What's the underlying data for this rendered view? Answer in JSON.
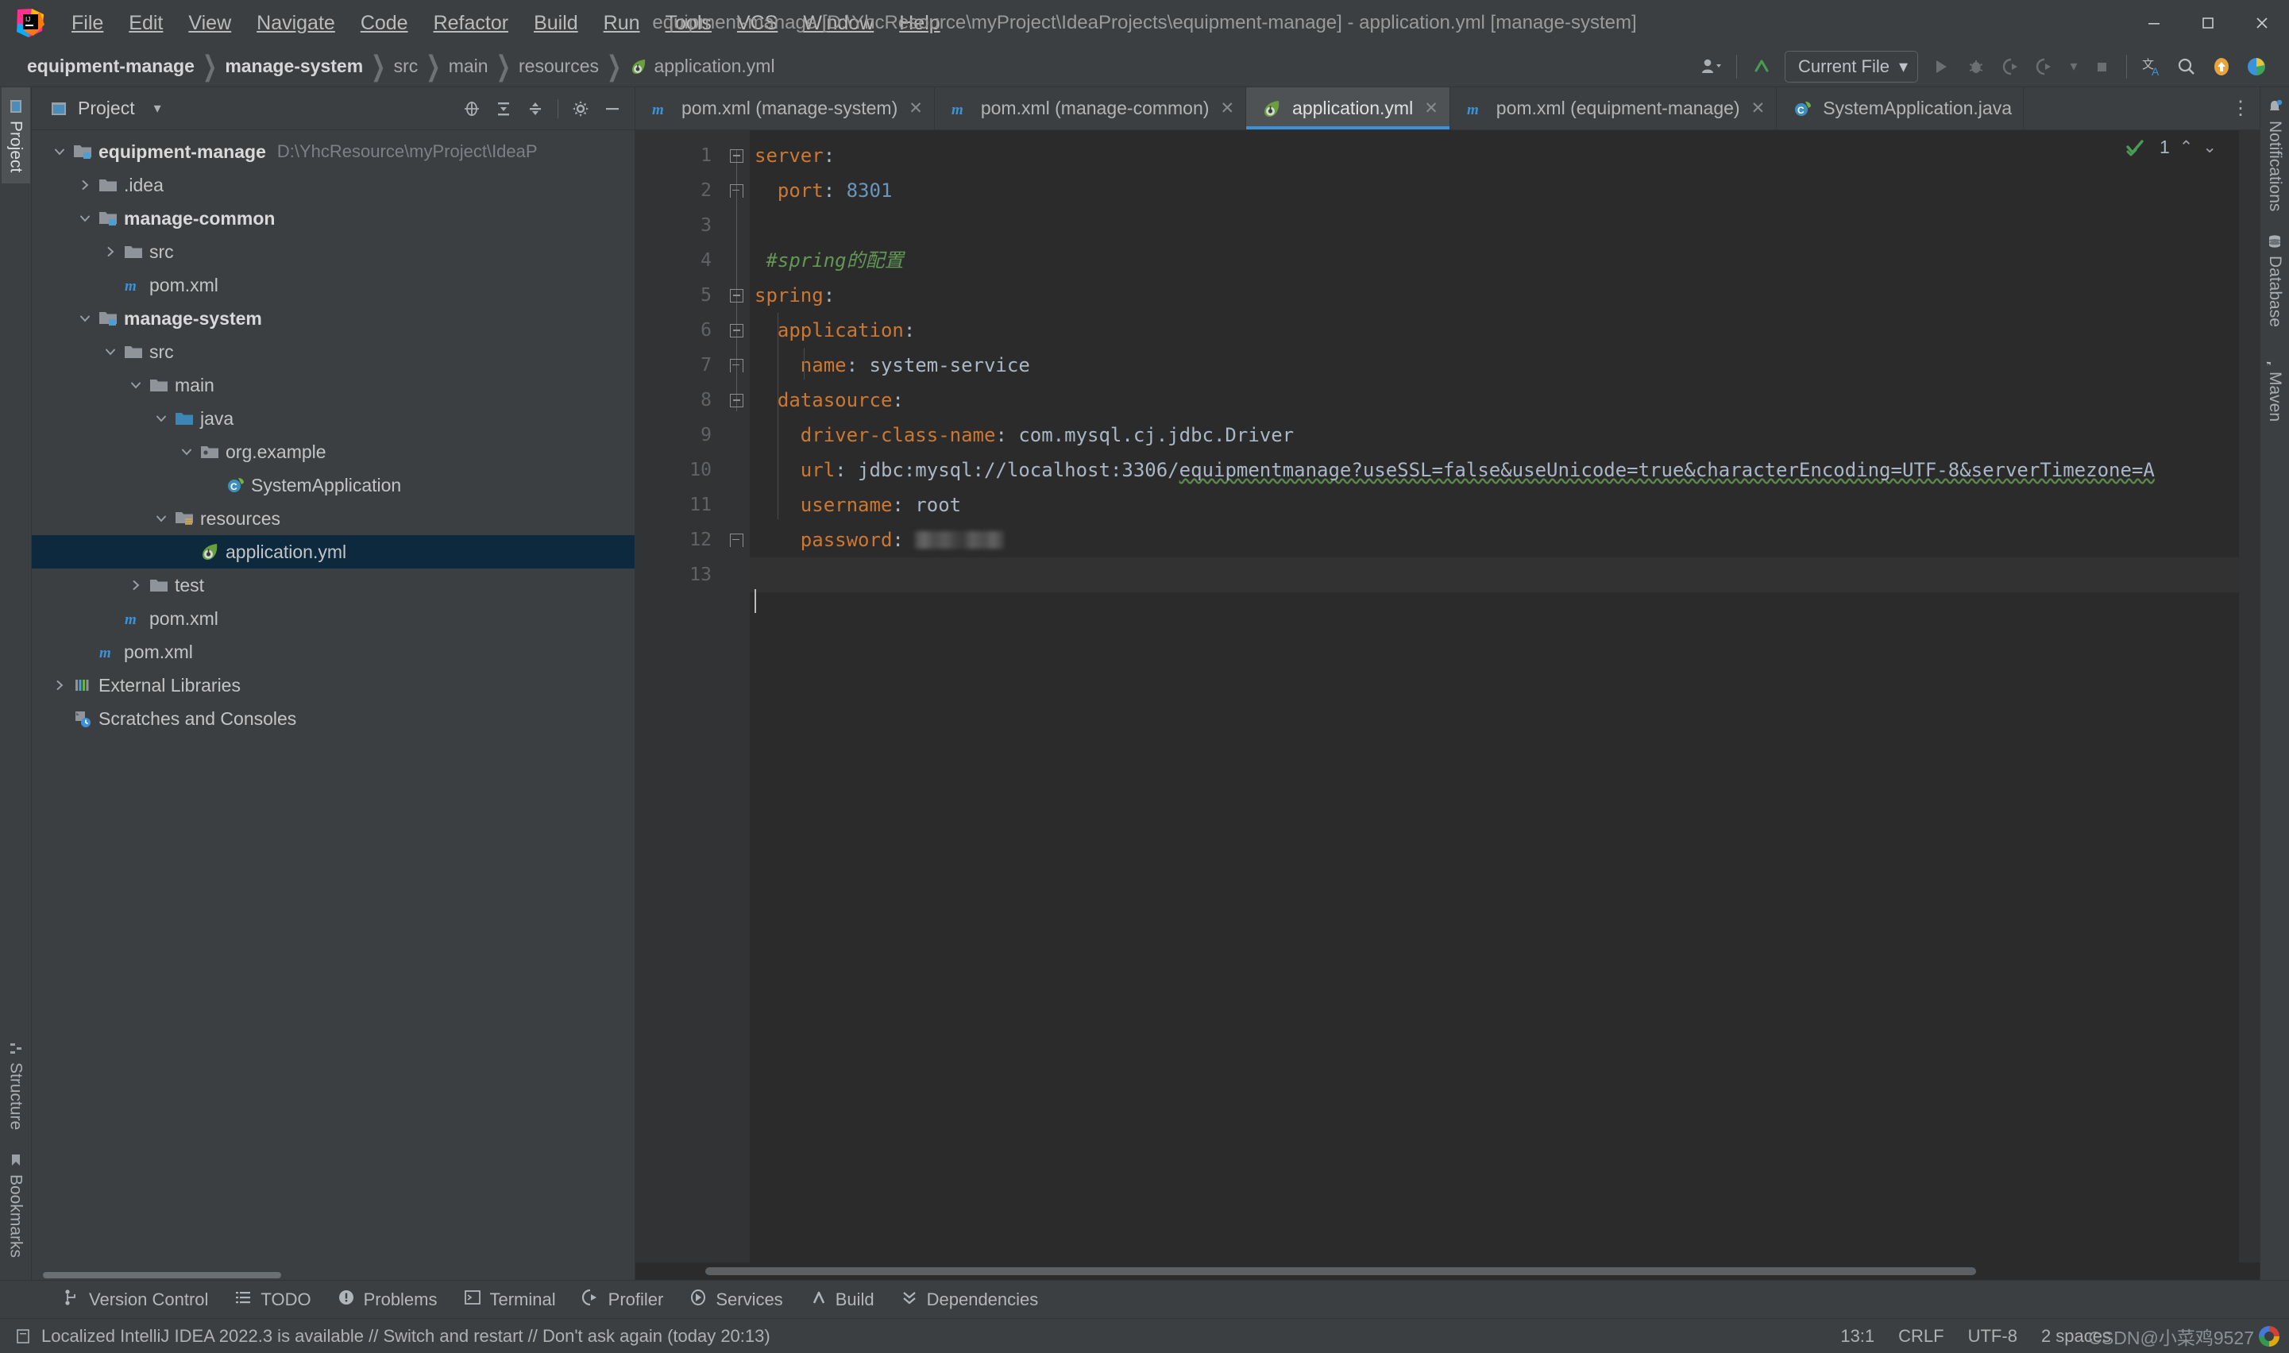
{
  "window": {
    "title": "equipment-manage [D:\\YhcResource\\myProject\\IdeaProjects\\equipment-manage] - application.yml [manage-system]",
    "minimize": "–",
    "maximize": "❐",
    "close": "✕"
  },
  "menu": [
    {
      "label": "File",
      "mnemonic": "F"
    },
    {
      "label": "Edit",
      "mnemonic": "E"
    },
    {
      "label": "View",
      "mnemonic": "V"
    },
    {
      "label": "Navigate",
      "mnemonic": "N"
    },
    {
      "label": "Code",
      "mnemonic": "C"
    },
    {
      "label": "Refactor",
      "mnemonic": "R"
    },
    {
      "label": "Build",
      "mnemonic": "B"
    },
    {
      "label": "Run",
      "mnemonic": "n"
    },
    {
      "label": "Tools",
      "mnemonic": "T"
    },
    {
      "label": "VCS",
      "mnemonic": "S"
    },
    {
      "label": "Window",
      "mnemonic": "W"
    },
    {
      "label": "Help",
      "mnemonic": "H"
    }
  ],
  "breadcrumbs": [
    {
      "label": "equipment-manage",
      "bold": true,
      "icon": null
    },
    {
      "label": "manage-system",
      "bold": true,
      "icon": null
    },
    {
      "label": "src",
      "bold": false,
      "icon": null
    },
    {
      "label": "main",
      "bold": false,
      "icon": null
    },
    {
      "label": "resources",
      "bold": false,
      "icon": null
    },
    {
      "label": "application.yml",
      "bold": false,
      "icon": "yaml-file-icon"
    }
  ],
  "toolbar": {
    "run_config": "Current File",
    "icons": [
      "user-account-icon",
      "updates-icon",
      "run-icon",
      "debug-icon",
      "run-coverage-icon",
      "profile-icon",
      "stop-icon",
      "translate-icon",
      "search-everywhere-icon",
      "update-project-icon",
      "ide-eye-icon"
    ]
  },
  "left_strip": {
    "top": [
      {
        "label": "Project",
        "icon": "project-icon",
        "active": true
      }
    ],
    "bottom": [
      {
        "label": "Structure",
        "icon": "structure-icon",
        "active": false
      },
      {
        "label": "Bookmarks",
        "icon": "bookmarks-icon",
        "active": false
      }
    ]
  },
  "right_strip": [
    {
      "label": "Notifications",
      "icon": "bell-icon"
    },
    {
      "label": "Database",
      "icon": "database-icon"
    },
    {
      "label": "Maven",
      "icon": "maven-icon"
    }
  ],
  "project_panel": {
    "title": "Project",
    "tools": [
      "locate-icon",
      "expand-all-icon",
      "collapse-all-icon",
      "gear-icon",
      "hide-icon"
    ],
    "tree": [
      {
        "depth": 0,
        "arrow": "down",
        "icon": "module-icon",
        "label": "equipment-manage",
        "bold": true,
        "path": "D:\\YhcResource\\myProject\\IdeaP",
        "selected": false
      },
      {
        "depth": 1,
        "arrow": "right",
        "icon": "folder-icon",
        "label": ".idea",
        "bold": false,
        "path": "",
        "selected": false
      },
      {
        "depth": 1,
        "arrow": "down",
        "icon": "module-icon",
        "label": "manage-common",
        "bold": true,
        "path": "",
        "selected": false
      },
      {
        "depth": 2,
        "arrow": "right",
        "icon": "folder-icon",
        "label": "src",
        "bold": false,
        "path": "",
        "selected": false
      },
      {
        "depth": 2,
        "arrow": "none",
        "icon": "maven-file-icon",
        "label": "pom.xml",
        "bold": false,
        "path": "",
        "selected": false
      },
      {
        "depth": 1,
        "arrow": "down",
        "icon": "module-icon",
        "label": "manage-system",
        "bold": true,
        "path": "",
        "selected": false
      },
      {
        "depth": 2,
        "arrow": "down",
        "icon": "folder-icon",
        "label": "src",
        "bold": false,
        "path": "",
        "selected": false
      },
      {
        "depth": 3,
        "arrow": "down",
        "icon": "folder-icon",
        "label": "main",
        "bold": false,
        "path": "",
        "selected": false
      },
      {
        "depth": 4,
        "arrow": "down",
        "icon": "source-root-icon",
        "label": "java",
        "bold": false,
        "path": "",
        "selected": false
      },
      {
        "depth": 5,
        "arrow": "down",
        "icon": "package-icon",
        "label": "org.example",
        "bold": false,
        "path": "",
        "selected": false
      },
      {
        "depth": 6,
        "arrow": "none",
        "icon": "spring-class-icon",
        "label": "SystemApplication",
        "bold": false,
        "path": "",
        "selected": false
      },
      {
        "depth": 4,
        "arrow": "down",
        "icon": "resource-root-icon",
        "label": "resources",
        "bold": false,
        "path": "",
        "selected": false
      },
      {
        "depth": 5,
        "arrow": "none",
        "icon": "yaml-file-icon",
        "label": "application.yml",
        "bold": false,
        "path": "",
        "selected": true
      },
      {
        "depth": 3,
        "arrow": "right",
        "icon": "folder-icon",
        "label": "test",
        "bold": false,
        "path": "",
        "selected": false
      },
      {
        "depth": 2,
        "arrow": "none",
        "icon": "maven-file-icon",
        "label": "pom.xml",
        "bold": false,
        "path": "",
        "selected": false
      },
      {
        "depth": 1,
        "arrow": "none",
        "icon": "maven-file-icon",
        "label": "pom.xml",
        "bold": false,
        "path": "",
        "selected": false
      },
      {
        "depth": 0,
        "arrow": "right",
        "icon": "libraries-icon",
        "label": "External Libraries",
        "bold": false,
        "path": "",
        "selected": false
      },
      {
        "depth": 0,
        "arrow": "none",
        "icon": "scratches-icon",
        "label": "Scratches and Consoles",
        "bold": false,
        "path": "",
        "selected": false
      }
    ]
  },
  "editor_tabs": [
    {
      "label": "pom.xml (manage-system)",
      "icon": "maven-file-icon",
      "active": false,
      "close": "✕"
    },
    {
      "label": "pom.xml (manage-common)",
      "icon": "maven-file-icon",
      "active": false,
      "close": "✕"
    },
    {
      "label": "application.yml",
      "icon": "yaml-file-icon",
      "active": true,
      "close": "✕"
    },
    {
      "label": "pom.xml (equipment-manage)",
      "icon": "maven-file-icon",
      "active": false,
      "close": "✕"
    },
    {
      "label": "SystemApplication.java",
      "icon": "spring-class-icon",
      "active": false,
      "close": ""
    }
  ],
  "inspection": {
    "count": "1",
    "up": "⌃",
    "down": "⌄"
  },
  "editor": {
    "filename": "application.yml",
    "line_numbers": [
      "1",
      "2",
      "3",
      "4",
      "5",
      "6",
      "7",
      "8",
      "9",
      "10",
      "11",
      "12",
      "13"
    ],
    "lines": [
      {
        "n": 1,
        "indent": 0,
        "fold": "start",
        "tokens": [
          {
            "t": "server",
            "c": "k"
          },
          {
            "t": ":",
            "c": "s"
          }
        ]
      },
      {
        "n": 2,
        "indent": 1,
        "fold": "end",
        "tokens": [
          {
            "t": "  port",
            "c": "k"
          },
          {
            "t": ": ",
            "c": "s"
          },
          {
            "t": "8301",
            "c": "n"
          }
        ]
      },
      {
        "n": 3,
        "indent": 0,
        "fold": "none",
        "tokens": []
      },
      {
        "n": 4,
        "indent": 0,
        "fold": "none",
        "tokens": [
          {
            "t": " #spring的配置",
            "c": "cm"
          }
        ]
      },
      {
        "n": 5,
        "indent": 0,
        "fold": "start",
        "tokens": [
          {
            "t": "spring",
            "c": "k"
          },
          {
            "t": ":",
            "c": "s"
          }
        ]
      },
      {
        "n": 6,
        "indent": 1,
        "fold": "start",
        "tokens": [
          {
            "t": "  application",
            "c": "k"
          },
          {
            "t": ":",
            "c": "s"
          }
        ]
      },
      {
        "n": 7,
        "indent": 2,
        "fold": "end",
        "tokens": [
          {
            "t": "    name",
            "c": "k"
          },
          {
            "t": ": system-service",
            "c": "s"
          }
        ]
      },
      {
        "n": 8,
        "indent": 1,
        "fold": "start",
        "tokens": [
          {
            "t": "  datasource",
            "c": "k"
          },
          {
            "t": ":",
            "c": "s"
          }
        ]
      },
      {
        "n": 9,
        "indent": 2,
        "fold": "none",
        "tokens": [
          {
            "t": "    driver-class-name",
            "c": "k"
          },
          {
            "t": ": com.mysql.cj.jdbc.Driver",
            "c": "s"
          }
        ]
      },
      {
        "n": 10,
        "indent": 2,
        "fold": "none",
        "tokens": [
          {
            "t": "    url",
            "c": "k"
          },
          {
            "t": ": jdbc:mysql://localhost:3306/",
            "c": "s"
          },
          {
            "t": "equipmentmanage?useSSL=false&useUnicode=true&characterEncoding=UTF-8&serverTimezone=A",
            "c": "s wavy"
          }
        ]
      },
      {
        "n": 11,
        "indent": 2,
        "fold": "none",
        "tokens": [
          {
            "t": "    username",
            "c": "k"
          },
          {
            "t": ": root",
            "c": "s"
          }
        ]
      },
      {
        "n": 12,
        "indent": 2,
        "fold": "end",
        "tokens": [
          {
            "t": "    password",
            "c": "k"
          },
          {
            "t": ": ",
            "c": "s"
          },
          {
            "t": "",
            "c": "blur"
          }
        ]
      },
      {
        "n": 13,
        "indent": 0,
        "fold": "none",
        "tokens": []
      }
    ]
  },
  "tool_windows": [
    {
      "label": "Version Control",
      "icon": "vcs-icon"
    },
    {
      "label": "TODO",
      "icon": "todo-icon"
    },
    {
      "label": "Problems",
      "icon": "problems-icon"
    },
    {
      "label": "Terminal",
      "icon": "terminal-icon"
    },
    {
      "label": "Profiler",
      "icon": "profiler-icon"
    },
    {
      "label": "Services",
      "icon": "services-icon"
    },
    {
      "label": "Build",
      "icon": "build-icon"
    },
    {
      "label": "Dependencies",
      "icon": "dependencies-icon"
    }
  ],
  "statusbar": {
    "message": "Localized IntelliJ IDEA 2022.3 is available // Switch and restart // Don't ask again (today 20:13)",
    "caret_position": "13:1",
    "line_separator": "CRLF",
    "encoding": "UTF-8",
    "indent": "2 spaces",
    "watermark": "CSDN@小菜鸡9527"
  },
  "colors": {
    "accent_blue": "#3c92d9",
    "selection_blue": "#0d293e",
    "editor_bg": "#2b2b2b",
    "panel_bg": "#3c3f41",
    "gutter_bg": "#313335",
    "key_orange": "#cc7832",
    "number_blue": "#6897bb",
    "comment_green": "#629755",
    "text": "#a9b7c6"
  }
}
